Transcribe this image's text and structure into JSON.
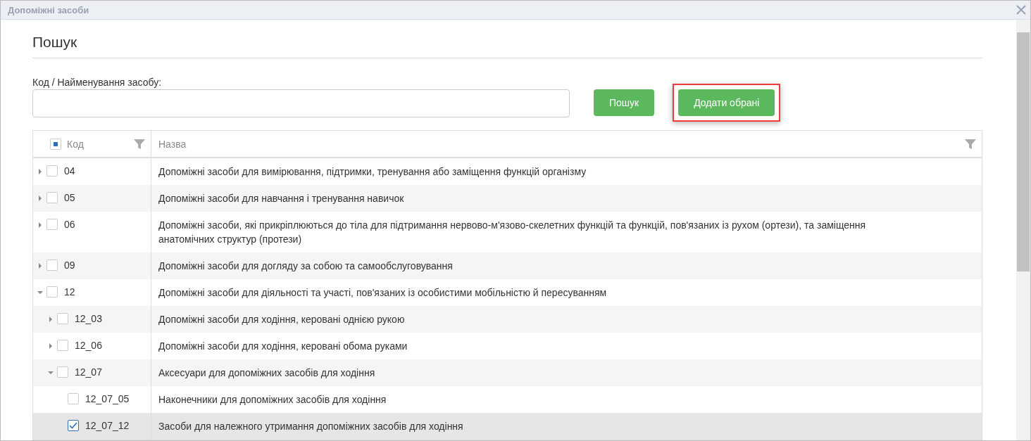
{
  "window": {
    "title": "Допоміжні засоби"
  },
  "heading": "Пошук",
  "search": {
    "label": "Код / Найменування засобу:"
  },
  "buttons": [
    {
      "label": "Пошук",
      "highlighted": false
    },
    {
      "label": "Додати обрані",
      "highlighted": true
    }
  ],
  "table": {
    "columns": [
      {
        "label": "Код",
        "partial": true
      },
      {
        "label": "Назва"
      }
    ],
    "rows": [
      {
        "code": "04",
        "name": "Допоміжні засоби для вимірювання, підтримки, тренування або заміщення функцій організму",
        "expanded": false,
        "checked": false,
        "selected": false
      },
      {
        "code": "05",
        "name": "Допоміжні засоби для навчання і тренування навичок",
        "expanded": false,
        "checked": false,
        "selected": false
      },
      {
        "code": "06",
        "name": "Допоміжні засоби, які прикріплюються до тіла для підтримання нервово-м'язово-скелетних функцій та функцій, пов'язаних із рухом (ортези), та заміщення анатомічних структур (протези)",
        "expanded": false,
        "checked": false,
        "selected": false
      },
      {
        "code": "09",
        "name": "Допоміжні засоби для догляду за собою та самообслуговування",
        "expanded": false,
        "checked": false,
        "selected": false
      },
      {
        "code": "12",
        "name": "Допоміжні засоби для діяльності та участі, пов'язаних із особистими мобільністю й пересуванням",
        "expanded": true,
        "checked": false,
        "selected": false,
        "children": [
          {
            "code": "12_03",
            "name": "Допоміжні засоби для ходіння, керовані однією рукою",
            "expanded": false,
            "checked": false,
            "selected": false
          },
          {
            "code": "12_06",
            "name": "Допоміжні засоби для ходіння, керовані обома руками",
            "expanded": false,
            "checked": false,
            "selected": false
          },
          {
            "code": "12_07",
            "name": "Аксесуари для допоміжних засобів для ходіння",
            "expanded": true,
            "checked": false,
            "selected": false,
            "children": [
              {
                "code": "12_07_05",
                "name": "Наконечники для допоміжних засобів для ходіння",
                "checked": false,
                "selected": false
              },
              {
                "code": "12_07_12",
                "name": "Засоби для належного утримання допоміжних засобів для ходіння",
                "checked": true,
                "selected": true
              }
            ]
          }
        ]
      }
    ]
  }
}
